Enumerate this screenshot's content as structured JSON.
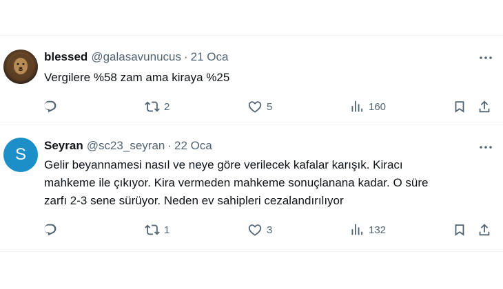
{
  "tweets": [
    {
      "avatar": "lion-photo",
      "name": "blessed",
      "handle": "@galasavunucus",
      "separator": "·",
      "date": "21 Oca",
      "text_lines": [
        "Vergilere %58 zam ama kiraya %25"
      ],
      "reply_count": "",
      "retweet_count": "2",
      "like_count": "5",
      "view_count": "160"
    },
    {
      "avatar_letter": "S",
      "avatar_color": "#1c8fc8",
      "name": "Seyran",
      "handle": "@sc23_seyran",
      "separator": "·",
      "date": "22 Oca",
      "text_lines": [
        "Gelir beyannamesi nasıl ve neye göre verilecek kafalar karışık. Kiracı",
        "mahkeme ile çıkıyor. Kira vermeden mahkeme sonuçlanana kadar. O süre",
        "zarfı 2-3 sene sürüyor. Neden ev sahipleri cezalandırılıyor"
      ],
      "reply_count": "",
      "retweet_count": "1",
      "like_count": "3",
      "view_count": "132"
    }
  ],
  "icons": {
    "reply": "reply-icon",
    "retweet": "retweet-icon",
    "like": "heart-icon",
    "views": "analytics-icon",
    "bookmark": "bookmark-icon",
    "share": "share-icon",
    "more": "more-icon"
  },
  "colors": {
    "text": "#0f1419",
    "secondary": "#536471",
    "divider": "#eff3f4"
  }
}
